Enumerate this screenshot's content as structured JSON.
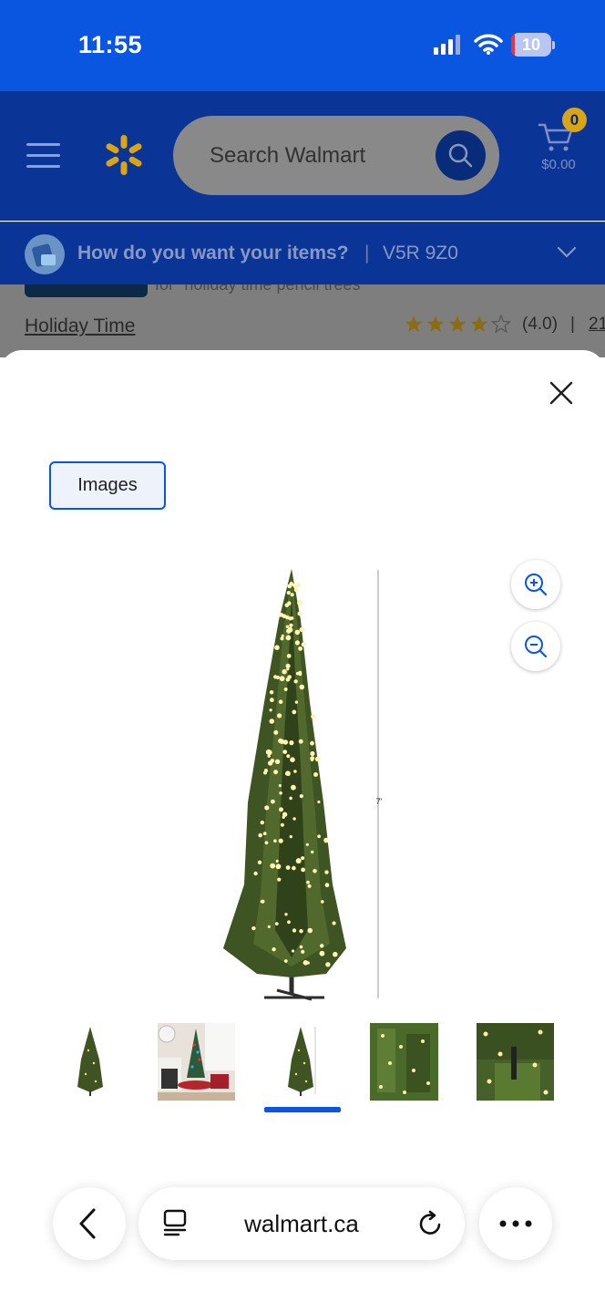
{
  "status_bar": {
    "time": "11:55",
    "battery": "10",
    "battery_level_fraction": 0.1,
    "icons": [
      "signal-icon",
      "wifi-icon",
      "battery-icon"
    ]
  },
  "header": {
    "search_placeholder": "Search Walmart",
    "cart_count": "0",
    "cart_total": "$0.00",
    "colors": {
      "header_bg": "#0a3596",
      "accent_yellow": "#d9a514",
      "status_blue": "#0b56e0"
    }
  },
  "delivery": {
    "question": "How do you want your items?",
    "separator": "|",
    "postal_code": "V5R 9Z0"
  },
  "product": {
    "partial_text": "for \"holiday time pencil trees\"",
    "brand": "Holiday Time",
    "rating": "(4.0)",
    "stars_filled": 4,
    "stars_total": 5,
    "rating_separator": "|",
    "review_count": "21"
  },
  "modal": {
    "tab_label": "Images",
    "height_label": "7'",
    "thumbnails": [
      "Pencil tree",
      "Living room scene",
      "Pencil tree with height",
      "Tree lights close-up",
      "Branch close-up"
    ],
    "selected_thumbnail": 2
  },
  "browser": {
    "url": "walmart.ca"
  }
}
